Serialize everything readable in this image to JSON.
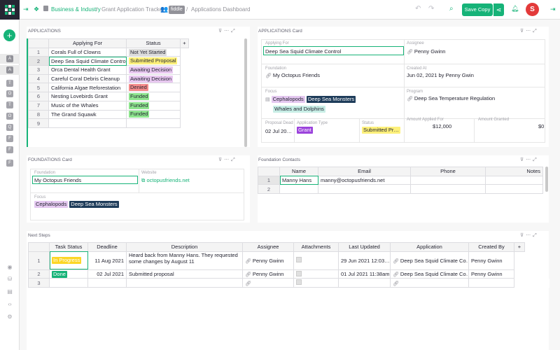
{
  "topbar": {
    "breadcrumb_org": "Business & Industry",
    "sep1": "/",
    "doc_name": "Grant Application Tracker",
    "fiddle_badge": "fiddle",
    "sep2": "/",
    "page_name": "Applications Dashboard",
    "save_copy_label": "Save Copy",
    "avatar_letter": "S"
  },
  "leftrail": {
    "icons": [
      "A",
      "A",
      "T",
      "O",
      "T",
      "O",
      "Q",
      "F",
      "F",
      "F"
    ]
  },
  "applications": {
    "title": "APPLICATIONS",
    "columns": [
      "Applying For",
      "Status"
    ],
    "add_col": "+",
    "rows": [
      {
        "n": "1",
        "applying_for": "Corals Full of Clowns",
        "status": "Not Yet Started"
      },
      {
        "n": "2",
        "applying_for": "Deep Sea Squid Climate Control",
        "status": "Submitted Proposal"
      },
      {
        "n": "3",
        "applying_for": "Orca Dental Health Grant",
        "status": "Awaiting Decision"
      },
      {
        "n": "4",
        "applying_for": "Careful Coral Debris Cleanup",
        "status": "Awaiting Decision"
      },
      {
        "n": "5",
        "applying_for": "California Algae Reforestation",
        "status": "Denied"
      },
      {
        "n": "6",
        "applying_for": "Nesting Lovebirds Grant",
        "status": "Funded"
      },
      {
        "n": "7",
        "applying_for": "Music of the Whales",
        "status": "Funded"
      },
      {
        "n": "8",
        "applying_for": "The Grand Squawk",
        "status": "Funded"
      },
      {
        "n": "9",
        "applying_for": "",
        "status": ""
      }
    ],
    "status_colors": {
      "Not Yet Started": "#dcdcdc",
      "Submitted Proposal": "#fdf07a",
      "Awaiting Decision": "#e8c8f0",
      "Denied": "#f48a8a",
      "Funded": "#8ee58e"
    }
  },
  "app_card": {
    "title": "APPLICATIONS Card",
    "applying_for_label": "Applying For",
    "applying_for": "Deep Sea Squid Climate Control",
    "assignee_label": "Assignee",
    "assignee": "Penny Gwinn",
    "foundation_label": "Foundation",
    "foundation": "My Octopus Friends",
    "created_at_label": "Created At",
    "created_at": "Jun 02, 2021 by Penny Gwin",
    "focus_label": "Focus",
    "focus_tags": [
      "Cephalopods",
      "Deep Sea Monsters",
      "Whales and Dolphins"
    ],
    "program_label": "Program",
    "program": "Deep Sea Temperature Regulation",
    "proposal_deadline_label": "Proposal Dead",
    "proposal_deadline": "02 Jul 20…",
    "application_type_label": "Application Type",
    "application_type": "Grant",
    "status_label": "Status",
    "status": "Submitted Pr…",
    "amount_applied_label": "Amount Applied For",
    "amount_applied": "$12,000",
    "amount_granted_label": "Amount Granted",
    "amount_granted": "$0"
  },
  "foundations_card": {
    "title": "FOUNDATIONS Card",
    "foundation_label": "Foundation",
    "foundation": "My Octopus Friends",
    "website_label": "Website",
    "website": "octopusfriends.net",
    "focus_label": "Focus",
    "focus_tags": [
      "Cephalopods",
      "Deep Sea Monsters"
    ]
  },
  "contacts": {
    "title": "Foundation Contacts",
    "columns": [
      "Name",
      "Email",
      "Phone",
      "Notes"
    ],
    "rows": [
      {
        "n": "1",
        "name": "Manny Hans",
        "email": "manny@octopusfriends.net",
        "phone": "",
        "notes": ""
      },
      {
        "n": "2",
        "name": "",
        "email": "",
        "phone": "",
        "notes": ""
      }
    ]
  },
  "next_steps": {
    "title": "Next Steps",
    "columns": [
      "Task Status",
      "Deadline",
      "Description",
      "Assignee",
      "Attachments",
      "Last Updated",
      "Application",
      "Created By"
    ],
    "add_col": "+",
    "rows": [
      {
        "n": "1",
        "task_status": "In Progress",
        "deadline": "11 Aug 2021",
        "description": "Heard back from Manny Hans. They requested some changes by August 11",
        "assignee": "Penny Gwinn",
        "last_updated": "29 Jun 2021 12:03…",
        "application": "Deep Sea Squid Climate Co…",
        "created_by": "Penny Gwinn"
      },
      {
        "n": "2",
        "task_status": "Done",
        "deadline": "02 Jul 2021",
        "description": "Submitted proposal",
        "assignee": "Penny Gwinn",
        "last_updated": "01 Jul 2021 11:38am",
        "application": "Deep Sea Squid Climate Co…",
        "created_by": "Penny Gwinn"
      },
      {
        "n": "3",
        "task_status": "",
        "deadline": "",
        "description": "",
        "assignee": "",
        "last_updated": "",
        "application": "",
        "created_by": ""
      }
    ],
    "task_colors": {
      "In Progress": "#fcd627",
      "Done": "#16b378"
    }
  },
  "colors": {
    "accent": "#16b378",
    "grant_pill": "#9b43dc",
    "tag_cephalopods": "#e4c8f0",
    "tag_deep_sea": "#1e3c5a",
    "tag_whales": "#c8eee6"
  }
}
